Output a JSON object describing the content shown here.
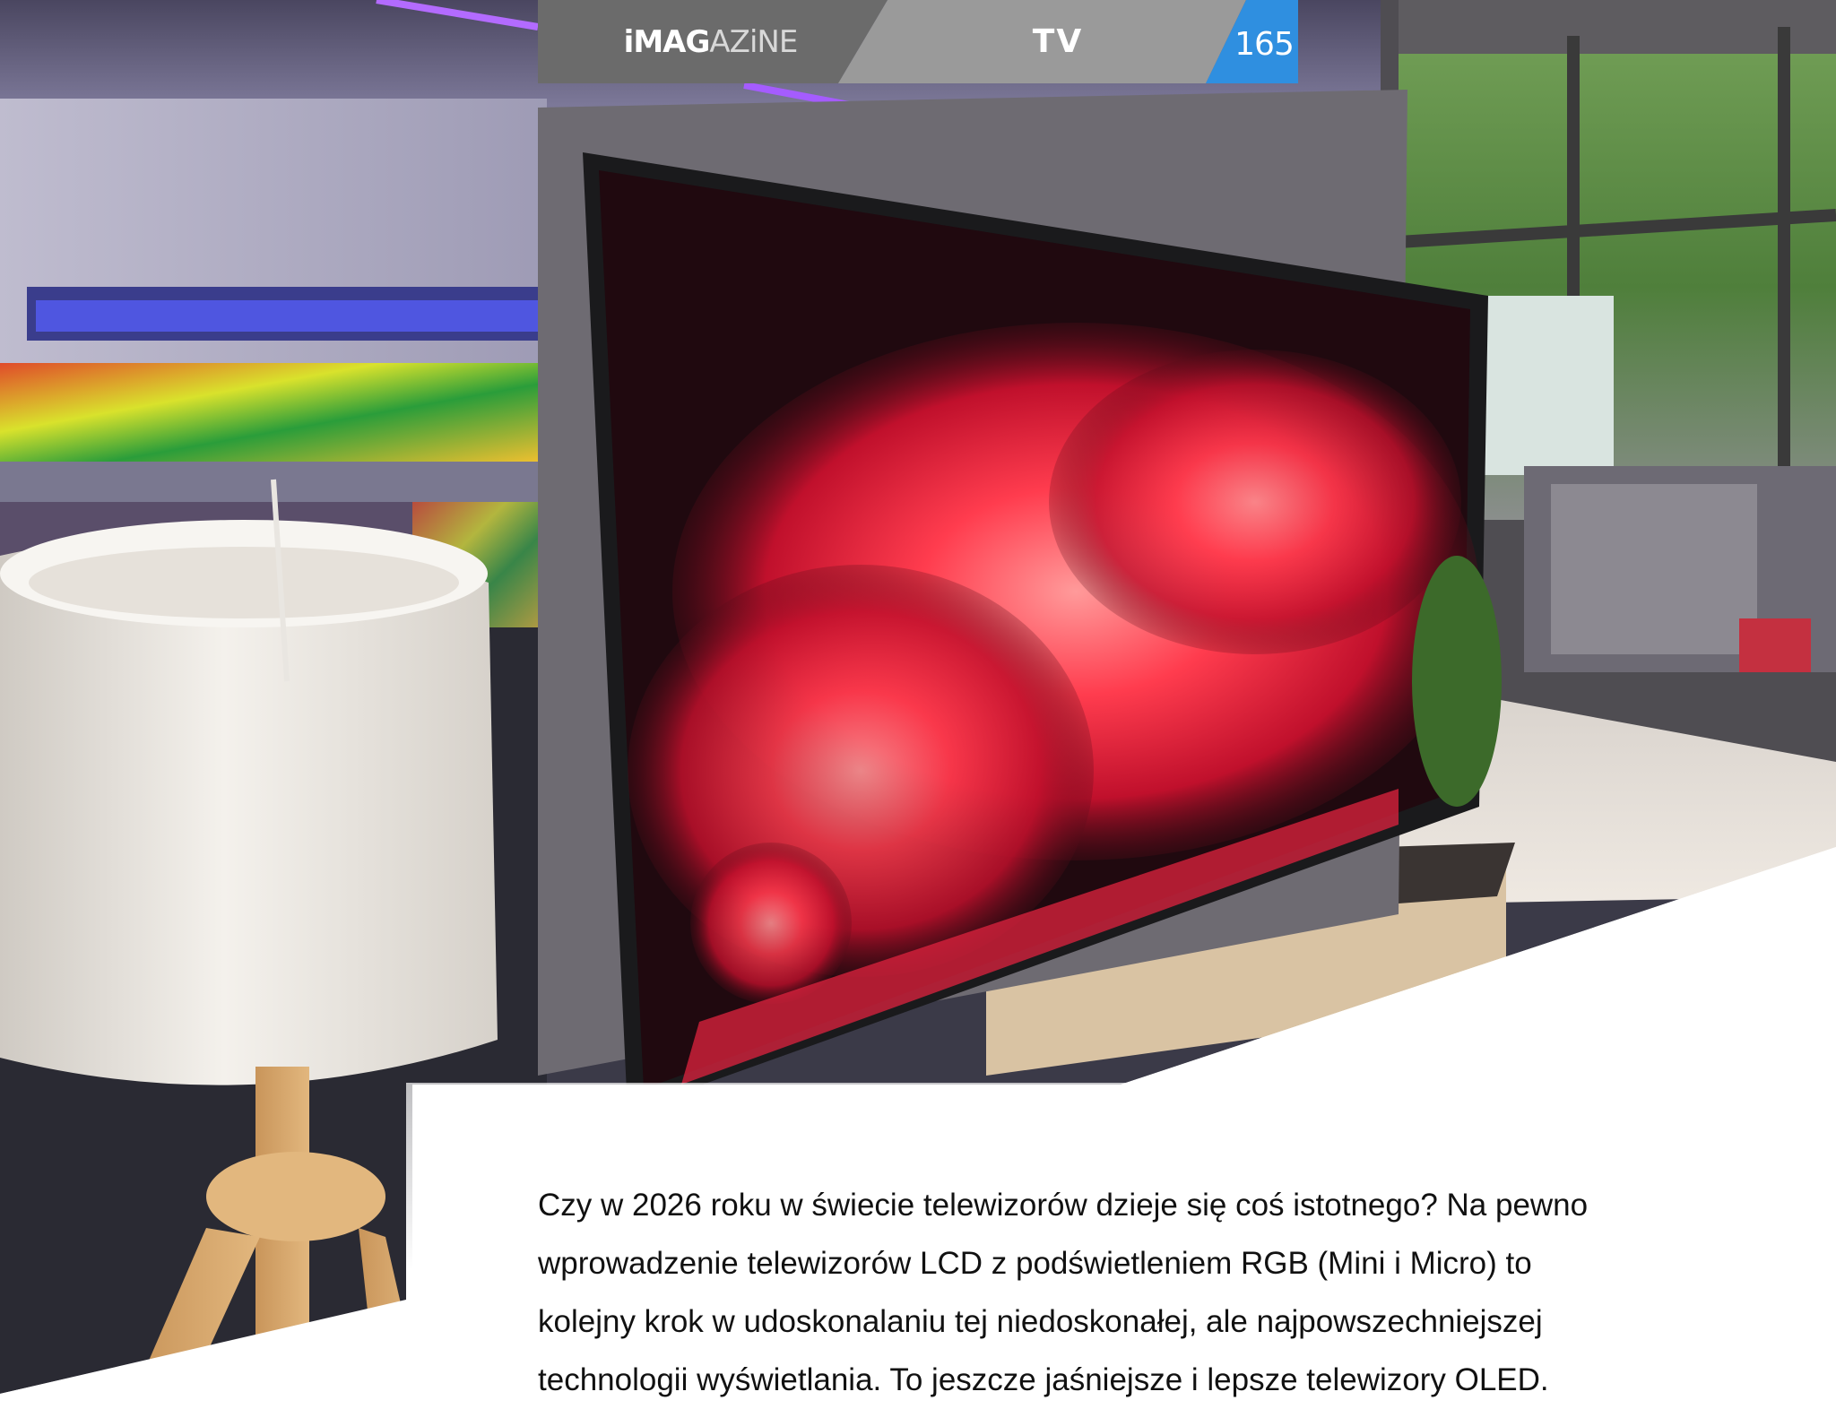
{
  "header": {
    "logo_text": "iMAGAZINE",
    "logo_bold": "iMAG",
    "logo_light": "AZiNE",
    "section_label": "TV",
    "page_number": "165"
  },
  "article": {
    "lines": [
      "Czy w 2026 roku w świecie telewizorów dzieje się coś istotnego? Na pewno",
      "wprowadzenie telewizorów LCD z podświetleniem RGB (Mini i Micro) to",
      "kolejny krok w udoskonalaniu tej niedoskonałej, ale najpowszechniejszej",
      "technologii wyświetlania. To jeszcze jaśniejsze i lepsze telewizory OLED."
    ]
  },
  "colors": {
    "header_dark": "#6b6b6b",
    "header_mid": "#9a9a9a",
    "page_accent": "#2f8fe0",
    "text": "#111111"
  }
}
